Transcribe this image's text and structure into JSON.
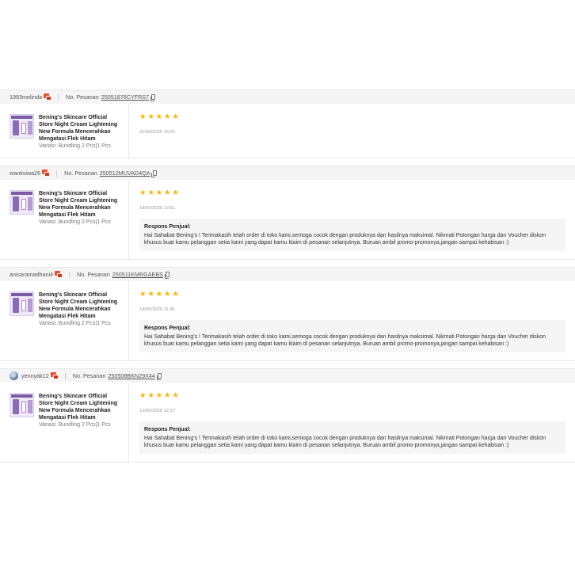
{
  "labels": {
    "order_prefix": "No. Pesanan",
    "response_title": "Respons Penjual:"
  },
  "colors": {
    "star": "#ffb400",
    "chat_badge": "#ee4d2d"
  },
  "reviews": [
    {
      "username": "1993melinda",
      "has_avatar": false,
      "order_id": "25051876CYFRS7",
      "product_name": "Bening's Skincare Official Store Night Cream Lightening New Formula Mencerahkan Mengatasi Flek Hitam",
      "variation": "Variasi: Bundling 2 Pcs|1 Pcs",
      "rating": 5,
      "date": "21/05/2025 16:52",
      "response": null
    },
    {
      "username": "wantisiwa26",
      "has_avatar": false,
      "order_id": "250512MUVAD4QA",
      "product_name": "Bening's Skincare Official Store Night Cream Lightening New Formula Mencerahkan Mengatasi Flek Hitam",
      "variation": "Variasi: Bundling 2 Pcs|1 Pcs",
      "rating": 5,
      "date": "18/05/2025 13:51",
      "response": "Hai Sahabat Bening's ! Terimakasih telah order di toko kami,semoga cocok dengan produknya dan hasilnya maksimal. Nikmati Potongan harga dan Voucher diskon khusus buat kamu pelanggan setia kami yang dapat kamu klaim di pesanan selanjutnya. Buruan ambil promo-promonya,jangan sampai kehabisan :)"
    },
    {
      "username": "anisaramadhani4",
      "has_avatar": false,
      "order_id": "250511KMRGAEBS",
      "product_name": "Bening's Skincare Official Store Night Cream Lightening New Formula Mencerahkan Mengatasi Flek Hitam",
      "variation": "Variasi: Bundling 2 Pcs|1 Pcs",
      "rating": 5,
      "date": "18/05/2025 11:46",
      "response": "Hai Sahabat Bening's ! Terimakasih telah order di toko kami,semoga cocok dengan produknya dan hasilnya maksimal. Nikmati Potongan harga dan Voucher diskon khusus buat kamu pelanggan setia kami yang dapat kamu klaim di pesanan selanjutnya. Buruan ambil promo-promonya,jangan sampai kehabisan :)"
    },
    {
      "username": "yennyak12",
      "has_avatar": true,
      "order_id": "250508BKN29X44",
      "product_name": "Bening's Skincare Official Store Night Cream Lightening New Formula Mencerahkan Mengatasi Flek Hitam",
      "variation": "Variasi: Bundling 2 Pcs|1 Pcs",
      "rating": 5,
      "date": "12/05/2025 12:27",
      "response": "Hai Sahabat Bening's ! Terimakasih telah order di toko kami,semoga cocok dengan produknya dan hasilnya maksimal. Nikmati Potongan harga dan Voucher diskon khusus buat kamu pelanggan setia kami yang dapat kamu klaim di pesanan selanjutnya. Buruan ambil promo-promonya,jangan sampai kehabisan :)"
    }
  ]
}
